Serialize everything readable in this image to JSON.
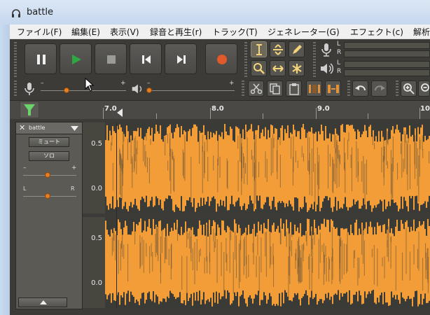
{
  "window": {
    "title": "battle"
  },
  "menu": [
    "ファイル(F)",
    "編集(E)",
    "表示(V)",
    "録音と再生(r)",
    "トラック(T)",
    "ジェネレーター(G)",
    "エフェクト(c)",
    "解析"
  ],
  "meters": {
    "left": "L",
    "right": "R"
  },
  "mixer": {
    "minus": "–",
    "plus": "+"
  },
  "ruler": {
    "labels": [
      "7.0",
      "8.0",
      "9.0",
      "10"
    ]
  },
  "track": {
    "name": "battle",
    "mute_label": "ミュート",
    "solo_label": "ソロ",
    "gain_minus": "–",
    "gain_plus": "+",
    "pan_left": "L",
    "pan_right": "R",
    "scale_top": [
      "0.5",
      "0.0"
    ],
    "scale_bottom": [
      "0.5",
      "0.0"
    ]
  },
  "colors": {
    "waveform": "#f29d38",
    "waveform_dark": "#3a3a36",
    "record": "#e05a2b",
    "play": "#2ea844"
  }
}
